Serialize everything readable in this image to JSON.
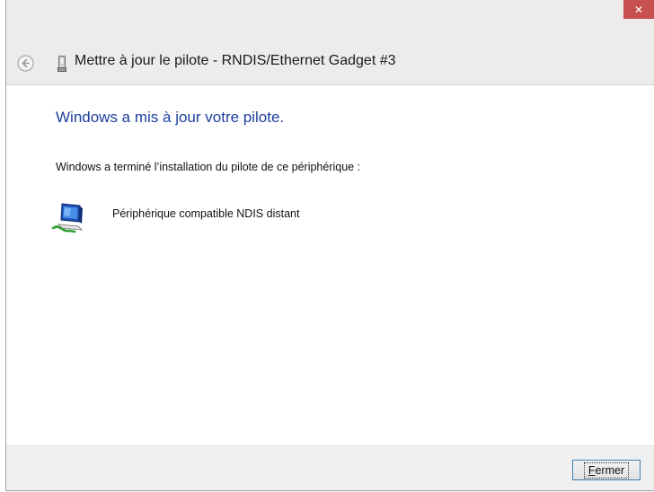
{
  "window": {
    "close_glyph": "✕",
    "close_color": "#c75050"
  },
  "header": {
    "title": "Mettre à jour le pilote - RNDIS/Ethernet Gadget #3",
    "back_icon": "back-arrow-icon",
    "device_icon": "usb-device-icon"
  },
  "main": {
    "heading": "Windows a mis à jour votre pilote.",
    "description": "Windows a terminé l’installation du pilote de ce périphérique :",
    "device": {
      "icon": "network-adapter-icon",
      "name": "Périphérique compatible NDIS distant"
    }
  },
  "footer": {
    "close_button": {
      "accel": "F",
      "rest": "ermer"
    }
  },
  "colors": {
    "heading": "#1e3f9e",
    "focus_border": "#3c7fb1"
  }
}
